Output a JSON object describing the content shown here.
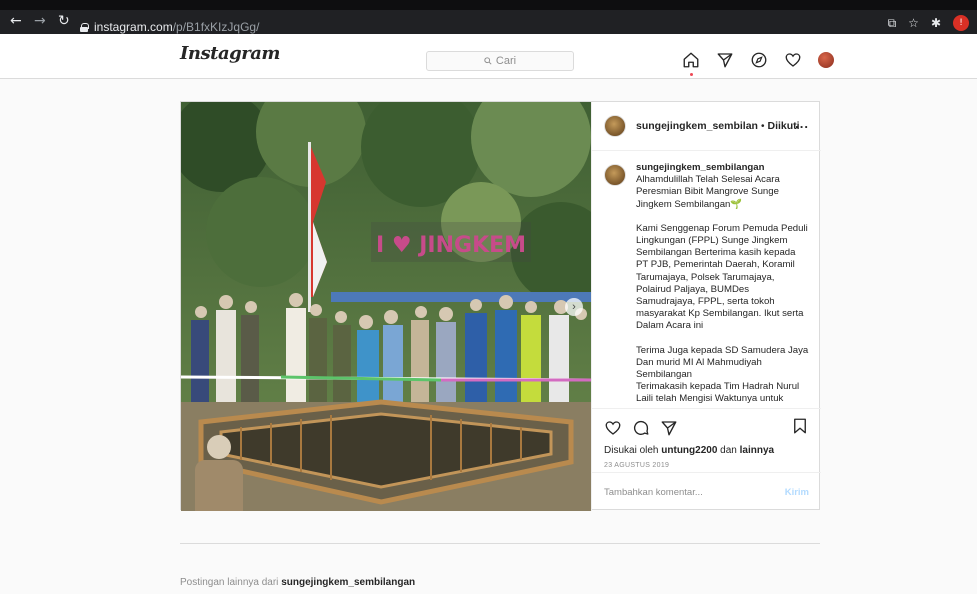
{
  "browser": {
    "url_host": "instagram.com",
    "url_path": "/p/B1fxKIzJqGg/",
    "back_icon": "arrow-left-icon",
    "forward_icon": "arrow-right-icon",
    "reload_icon": "reload-icon",
    "extension_badge": "!"
  },
  "header": {
    "logo": "Instagram",
    "search_placeholder": "Cari",
    "icons": [
      "home-icon",
      "direct-icon",
      "explore-icon",
      "activity-icon",
      "profile-avatar"
    ]
  },
  "post": {
    "username": "sungejingkem_sembilan",
    "follow_state": "Diikuti",
    "more_label": "...",
    "caption_user": "sungejingkem_sembilangan",
    "caption_paragraphs": [
      "Alhamdulillah Telah Selesai Acara Peresmian Bibit Mangrove Sunge Jingkem Sembilangan",
      "Kami Senggenap Forum Pemuda Peduli Lingkungan (FPPL) Sunge Jingkem Sembilangan Berterima kasih kepada PT PJB, Pemerintah Daerah, Koramil Tarumajaya, Polsek Tarumajaya, Polairud Paljaya, BUMDes Samudrajaya, FPPL, serta tokoh masyarakat Kp Sembilangan. Ikut serta Dalam Acara ini",
      "Terima Juga kepada SD Samudera Jaya Dan murid MI Al Mahmudiyah Sembilangan\nTerimakasih kepada Tim Hadrah Nurul Laili telah Mengisi Waktunya untuk"
    ],
    "caption_emoji": "🌱",
    "likes_prefix": "Disukai oleh",
    "likes_user": "untung2200",
    "likes_and": "dan",
    "likes_others": "lainnya",
    "date": "23 AGUSTUS 2019",
    "comment_placeholder": "Tambahkan komentar...",
    "post_button": "Kirim",
    "photo_sign_text": "I ♥ JINGKEM"
  },
  "more_posts": {
    "prefix": "Postingan lainnya dari",
    "user": "sungejingkem_sembilangan"
  }
}
